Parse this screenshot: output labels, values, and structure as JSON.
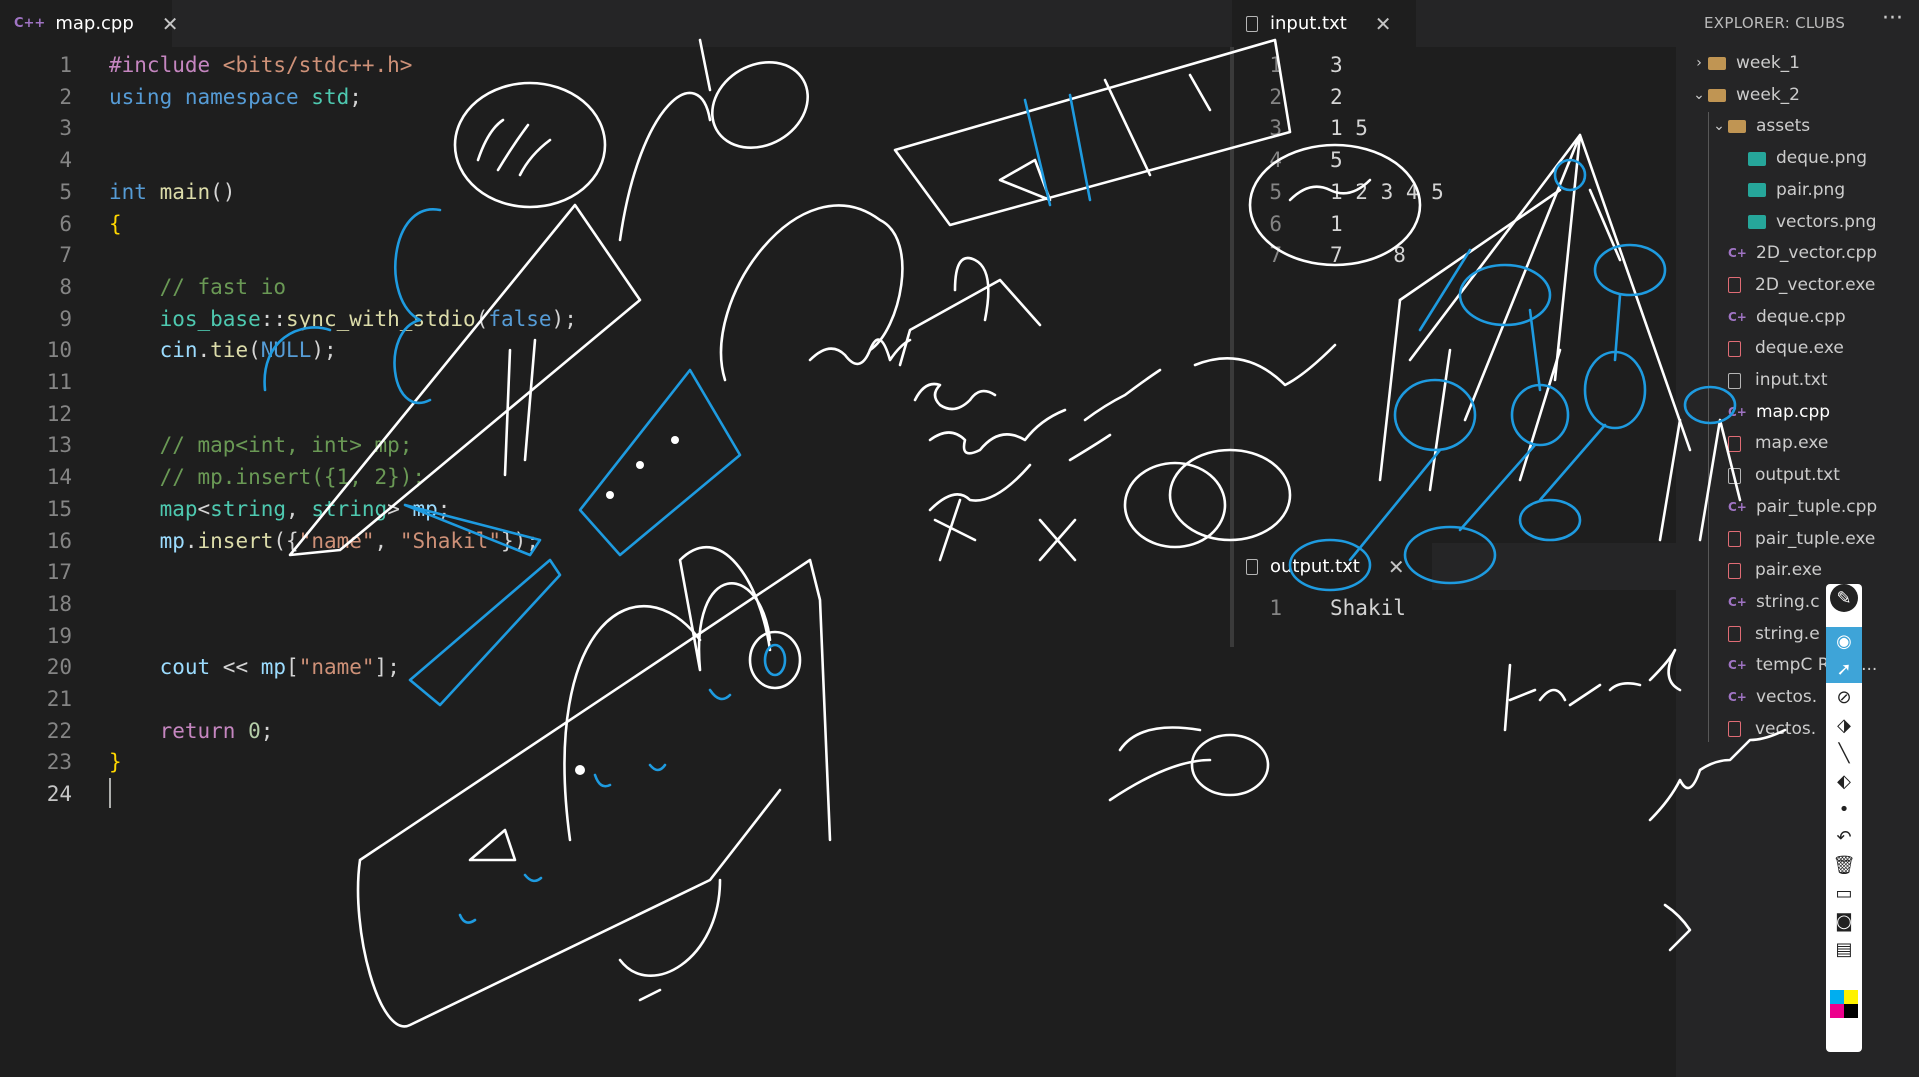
{
  "editor_tab": {
    "badge": "C++",
    "label": "map.cpp",
    "close": "✕"
  },
  "input_tab": {
    "label": "input.txt",
    "close": "✕"
  },
  "output_tab": {
    "label": "output.txt",
    "close": "✕"
  },
  "explorer": {
    "title": "EXPLORER: CLUBS",
    "more": "···",
    "items": [
      {
        "label": "week_1",
        "kind": "folder",
        "expanded": false
      },
      {
        "label": "week_2",
        "kind": "folder",
        "expanded": true
      },
      {
        "label": "assets",
        "kind": "folder",
        "expanded": true
      },
      {
        "label": "deque.png",
        "kind": "image"
      },
      {
        "label": "pair.png",
        "kind": "image"
      },
      {
        "label": "vectors.png",
        "kind": "image"
      },
      {
        "label": "2D_vector.cpp",
        "kind": "cpp"
      },
      {
        "label": "2D_vector.exe",
        "kind": "exe"
      },
      {
        "label": "deque.cpp",
        "kind": "cpp"
      },
      {
        "label": "deque.exe",
        "kind": "exe"
      },
      {
        "label": "input.txt",
        "kind": "txt"
      },
      {
        "label": "map.cpp",
        "kind": "cpp",
        "selected": true
      },
      {
        "label": "map.exe",
        "kind": "exe"
      },
      {
        "label": "output.txt",
        "kind": "txt"
      },
      {
        "label": "pair_tuple.cpp",
        "kind": "cpp"
      },
      {
        "label": "pair_tuple.exe",
        "kind": "exe"
      },
      {
        "label": "pair.exe",
        "kind": "exe"
      },
      {
        "label": "string.c",
        "kind": "cpp"
      },
      {
        "label": "string.e",
        "kind": "exe"
      },
      {
        "label": "tempC    Runn...",
        "kind": "cpp"
      },
      {
        "label": "vectos.",
        "kind": "cpp"
      },
      {
        "label": "vectos.",
        "kind": "exe"
      }
    ]
  },
  "code_lines": [
    [
      {
        "t": "#include ",
        "c": "dir"
      },
      {
        "t": "<bits/stdc++.h>",
        "c": "inc"
      }
    ],
    [
      {
        "t": "using ",
        "c": "kw"
      },
      {
        "t": "namespace ",
        "c": "kw"
      },
      {
        "t": "std",
        "c": "type"
      },
      {
        "t": ";",
        "c": "plain"
      }
    ],
    [],
    [],
    [
      {
        "t": "int ",
        "c": "kw"
      },
      {
        "t": "main",
        "c": "fn"
      },
      {
        "t": "()",
        "c": "plain"
      }
    ],
    [
      {
        "t": "{",
        "c": "brace"
      }
    ],
    [],
    [
      {
        "t": "    // fast io",
        "c": "cmt"
      }
    ],
    [
      {
        "t": "    ios_base",
        "c": "type"
      },
      {
        "t": "::",
        "c": "plain"
      },
      {
        "t": "sync_with_stdio",
        "c": "fn"
      },
      {
        "t": "(",
        "c": "plain"
      },
      {
        "t": "false",
        "c": "kw"
      },
      {
        "t": ");",
        "c": "plain"
      }
    ],
    [
      {
        "t": "    cin",
        "c": "var"
      },
      {
        "t": ".",
        "c": "plain"
      },
      {
        "t": "tie",
        "c": "fn"
      },
      {
        "t": "(",
        "c": "plain"
      },
      {
        "t": "NULL",
        "c": "kw"
      },
      {
        "t": ");",
        "c": "plain"
      }
    ],
    [],
    [],
    [
      {
        "t": "    // map<int, int> mp;",
        "c": "cmt"
      }
    ],
    [
      {
        "t": "    // mp.insert({1, 2});",
        "c": "cmt"
      }
    ],
    [
      {
        "t": "    map",
        "c": "type"
      },
      {
        "t": "<",
        "c": "plain"
      },
      {
        "t": "string",
        "c": "type"
      },
      {
        "t": ", ",
        "c": "plain"
      },
      {
        "t": "string",
        "c": "type"
      },
      {
        "t": "> ",
        "c": "plain"
      },
      {
        "t": "mp",
        "c": "var"
      },
      {
        "t": ";",
        "c": "plain"
      }
    ],
    [
      {
        "t": "    mp",
        "c": "var"
      },
      {
        "t": ".",
        "c": "plain"
      },
      {
        "t": "insert",
        "c": "fn"
      },
      {
        "t": "({",
        "c": "plain"
      },
      {
        "t": "\"name\"",
        "c": "str"
      },
      {
        "t": ", ",
        "c": "plain"
      },
      {
        "t": "\"Shakil\"",
        "c": "str"
      },
      {
        "t": "});",
        "c": "plain"
      }
    ],
    [],
    [],
    [],
    [
      {
        "t": "    cout ",
        "c": "var"
      },
      {
        "t": "<< ",
        "c": "plain"
      },
      {
        "t": "mp",
        "c": "var"
      },
      {
        "t": "[",
        "c": "plain"
      },
      {
        "t": "\"name\"",
        "c": "str"
      },
      {
        "t": "];",
        "c": "plain"
      }
    ],
    [],
    [
      {
        "t": "    return ",
        "c": "dir"
      },
      {
        "t": "0",
        "c": "num"
      },
      {
        "t": ";",
        "c": "plain"
      }
    ],
    [
      {
        "t": "}",
        "c": "brace"
      }
    ],
    []
  ],
  "current_line": 24,
  "input_lines": [
    "3",
    "2",
    "1 5",
    "5",
    "1 2 3 4 5",
    "1",
    "7    8"
  ],
  "output_lines": [
    "Shakil"
  ],
  "toolbar_tools": [
    "pen-tool",
    "highlighter-tool",
    "select-tool",
    "lasso-tool",
    "eraser-area-tool",
    "line-tool",
    "eraser-tool",
    "dot-size",
    "undo",
    "delete",
    "whiteboard",
    "screenshot",
    "clipboard",
    "color-palette"
  ],
  "colors": {
    "ink_white": "#ffffff",
    "ink_blue": "#1e9be0",
    "accent": "#3ea4d8"
  }
}
